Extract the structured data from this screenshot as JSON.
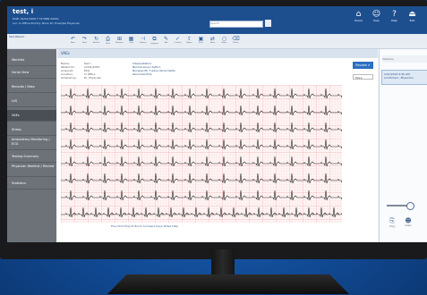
{
  "header": {
    "title": "test, i",
    "line1": "DOB: 01/01/1990  F 33  MRN 00001",
    "line2": "Loc: In Office  Priority: None  Dr: Example Physician",
    "search_placeholder": "Search",
    "icons": [
      {
        "name": "home-icon",
        "label": "Home",
        "glyph": "⌂"
      },
      {
        "name": "user-icon",
        "label": "User",
        "glyph": "👤"
      },
      {
        "name": "help-icon",
        "label": "Help",
        "glyph": "?"
      },
      {
        "name": "exit-icon",
        "label": "Exit",
        "glyph": "⏏"
      }
    ]
  },
  "toolbar": {
    "patient": "Test Patient",
    "buttons": [
      "Back",
      "Next",
      "Refresh",
      "Print",
      "Measure",
      "Grid",
      "Calipers",
      "Compare",
      "Edit",
      "Confirm",
      "Export",
      "Save",
      "Share",
      "Notes",
      "Delete"
    ]
  },
  "sidebar": {
    "items": [
      "Worklist",
      "Serial View",
      "Records / Data",
      "LVS",
      "VAEs",
      "Stress",
      "Ambulatory Monitoring / ECG",
      "Testing Summary",
      "Physician Worklist / Review",
      "Statistics"
    ],
    "active_index": 4
  },
  "main": {
    "title": "VAEs",
    "info_col1": [
      "Name:",
      "Patient ID:",
      "Acquired:",
      "Location:",
      "Ordered by:"
    ],
    "info_col2": [
      "test i",
      "12/01/2023",
      "ECG",
      "In Office",
      "Dr. Physician"
    ],
    "interp_label": "Interpretation:",
    "interp_lines": [
      "Normal sinus rhythm",
      "Nonspecific T wave abnormality",
      "Abnormal ECG"
    ],
    "review_button": "Review ✔",
    "select_value": "More",
    "bottom_bar": "Prev   Print   Export   Zoom   Compare   Save   Notes   Help"
  },
  "right_panel": {
    "header": "Versions",
    "card_title": "12/1/2023 9:45 AM",
    "card_sub": "Confirmed - Physician"
  }
}
